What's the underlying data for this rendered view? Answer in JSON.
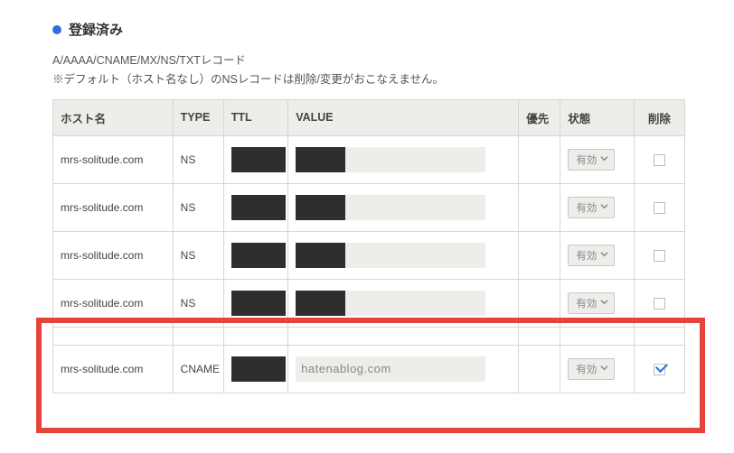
{
  "section": {
    "title": "登録済み",
    "subtitle": "A/AAAA/CNAME/MX/NS/TXTレコード",
    "note": "※デフォルト（ホスト名なし）のNSレコードは削除/変更がおこなえません。"
  },
  "columns": {
    "host": "ホスト名",
    "type": "TYPE",
    "ttl": "TTL",
    "value": "VALUE",
    "priority": "優先",
    "status": "状態",
    "delete": "削除"
  },
  "rows": [
    {
      "host": "mrs-solitude.com",
      "type": "NS",
      "value_text": "",
      "status": "有効",
      "checked": false
    },
    {
      "host": "mrs-solitude.com",
      "type": "NS",
      "value_text": "",
      "status": "有効",
      "checked": false
    },
    {
      "host": "mrs-solitude.com",
      "type": "NS",
      "value_text": "",
      "status": "有効",
      "checked": false
    },
    {
      "host": "mrs-solitude.com",
      "type": "NS",
      "value_text": "",
      "status": "有効",
      "checked": false
    },
    {
      "host": "mrs-solitude.com",
      "type": "CNAME",
      "value_text": "hatenablog.com",
      "status": "有効",
      "checked": true
    }
  ]
}
